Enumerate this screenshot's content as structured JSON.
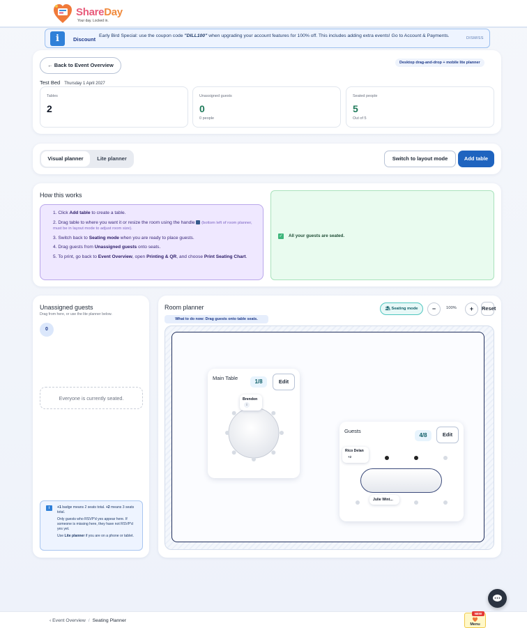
{
  "brand": {
    "name_part1": "Share",
    "name_part2": "Day",
    "tagline": "Your day. Locked in."
  },
  "banner": {
    "label": "Discount",
    "text_before": "Early Bird Special: use the coupon code ",
    "coupon": "\"DILL100\"",
    "text_after": " when upgrading your account features for 100% off. This includes adding extra events! Go to Account & Payments.",
    "dismiss": "DISMISS"
  },
  "overview": {
    "back_label": "← Back to Event Overview",
    "mode_tag": "Desktop drag-and-drop + mobile lite planner",
    "event_name": "Test Bed",
    "event_date": "Thursday 1 April 2027",
    "stats": [
      {
        "label": "Tables",
        "value": "2",
        "sub": ""
      },
      {
        "label": "Unassigned guests",
        "value": "0",
        "sub": "0 people"
      },
      {
        "label": "Seated people",
        "value": "5",
        "sub": "Out of 5"
      }
    ]
  },
  "modebar": {
    "tab_visual": "Visual planner",
    "tab_lite": "Lite planner",
    "switch_layout": "Switch to layout mode",
    "add_table": "Add table"
  },
  "how": {
    "title": "How this works",
    "steps": [
      {
        "pre": "1. Click ",
        "bold": "Add table",
        "post": " to create a table."
      },
      {
        "pre": "2. Drag table to where you want it or resize the room using the handle ",
        "bold": "",
        "post": "",
        "muted": "(bottom left of room planner, must be in layout mode to adjust room size)."
      },
      {
        "pre": "3. Switch back to ",
        "bold": "Seating mode",
        "post": " when you are ready to place guests."
      },
      {
        "pre": "4. Drag guests from ",
        "bold": "Unassigned guests",
        "post": " onto seats."
      },
      {
        "pre": "5. To print, go back to ",
        "bold": "Event Overview",
        "post": ", open ",
        "bold2": "Printing & QR",
        "post2": ", and choose ",
        "bold3": "Print Seating Chart",
        "post3": "."
      }
    ],
    "seated_message": "All your guests are seated."
  },
  "unassigned": {
    "title": "Unassigned guests",
    "subtitle": "Drag from here, or use the lite planner below.",
    "count": "0",
    "empty": "Everyone is currently seated.",
    "note_p1_b1": "+1",
    "note_p1_t1": " badge means 2 seats total. ",
    "note_p1_b2": "+2",
    "note_p1_t2": " means 3 seats total.",
    "note_p2": "Only guests who RSVP'd yes appear here. If someone is missing here, they have not RSVP'd yes yet.",
    "note_p3_t1": "Use ",
    "note_p3_b": "Lite planner",
    "note_p3_t2": " if you are on a phone or tablet."
  },
  "room": {
    "title": "Room planner",
    "todo": "What to do now: Drag guests onto table seats.",
    "seating_mode": "⛱ Seating mode",
    "zoom_out": "−",
    "zoom_level": "100%",
    "zoom_in": "+",
    "reset": "Reset",
    "tables": [
      {
        "name": "Main Table",
        "count": "1/8",
        "edit": "Edit",
        "guests": [
          {
            "name": "Brendon",
            "badge": "i"
          }
        ]
      },
      {
        "name": "Guests",
        "count": "4/8",
        "edit": "Edit",
        "guests": [
          {
            "name": "Rico Delan",
            "badge": "+2"
          },
          {
            "name": "Julie Wint...",
            "badge": ""
          }
        ]
      }
    ]
  },
  "footer": {
    "crumb_parent": "‹ Event Overview",
    "crumb_sep": "/",
    "crumb_current": "Seating Planner",
    "menu_new": "NEW",
    "menu_label": "Menu"
  },
  "colors": {
    "primary": "#1f64bf",
    "accent_teal": "#0f5e67",
    "success_bg": "#e9fbef",
    "info_bg": "#efe8ff"
  },
  "icons": [
    "info-icon",
    "check-icon",
    "chat-icon",
    "umbrella-icon"
  ]
}
